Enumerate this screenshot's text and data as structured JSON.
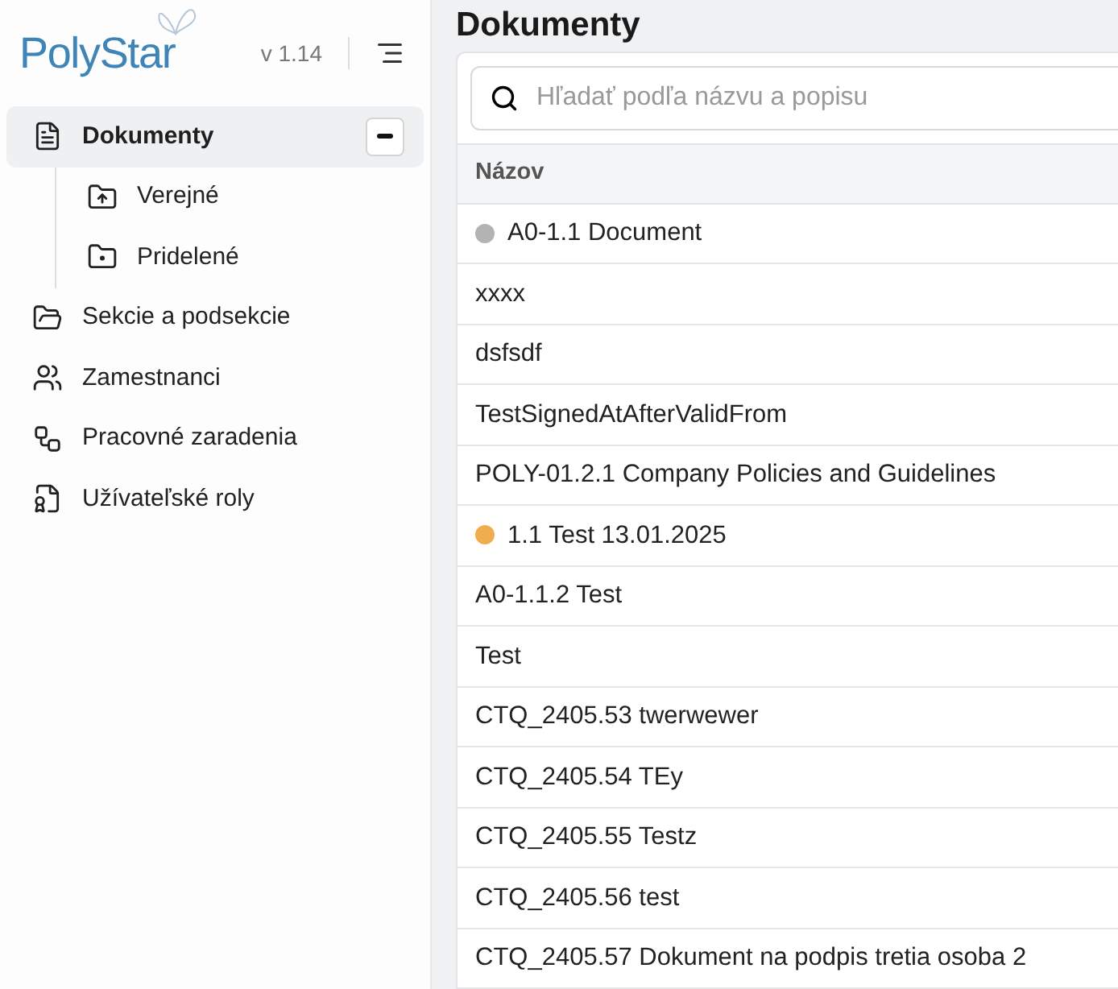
{
  "sidebar": {
    "logo": "PolyStar",
    "version": "v 1.14",
    "items": [
      {
        "label": "Dokumenty",
        "selected": true,
        "expanded": true,
        "children": [
          {
            "label": "Verejné",
            "selected": false
          },
          {
            "label": "Pridelené",
            "selected": false
          }
        ]
      },
      {
        "label": "Sekcie a podsekcie",
        "selected": false
      },
      {
        "label": "Zamestnanci",
        "selected": false
      },
      {
        "label": "Pracovné zaradenia",
        "selected": false
      },
      {
        "label": "Užívateľské roly",
        "selected": false
      }
    ]
  },
  "page": {
    "title": "Dokumenty"
  },
  "search": {
    "placeholder": "Hľadať podľa názvu a popisu"
  },
  "table": {
    "columns": [
      "Názov"
    ],
    "rows": [
      {
        "name": "A0-1.1 Document",
        "color": "#b3b3b3"
      },
      {
        "name": "xxxx"
      },
      {
        "name": "dsfsdf"
      },
      {
        "name": "TestSignedAtAfterValidFrom"
      },
      {
        "name": "POLY-01.2.1 Company Policies and Guidelines"
      },
      {
        "name": "1.1 Test 13.01.2025",
        "color": "#f0ad4e"
      },
      {
        "name": "A0-1.1.2 Test"
      },
      {
        "name": "Test"
      },
      {
        "name": "CTQ_2405.53 twerwewer"
      },
      {
        "name": "CTQ_2405.54 TEy"
      },
      {
        "name": "CTQ_2405.55 Testz"
      },
      {
        "name": "CTQ_2405.56 test"
      },
      {
        "name": "CTQ_2405.57 Dokument na podpis tretia osoba 2"
      }
    ]
  }
}
